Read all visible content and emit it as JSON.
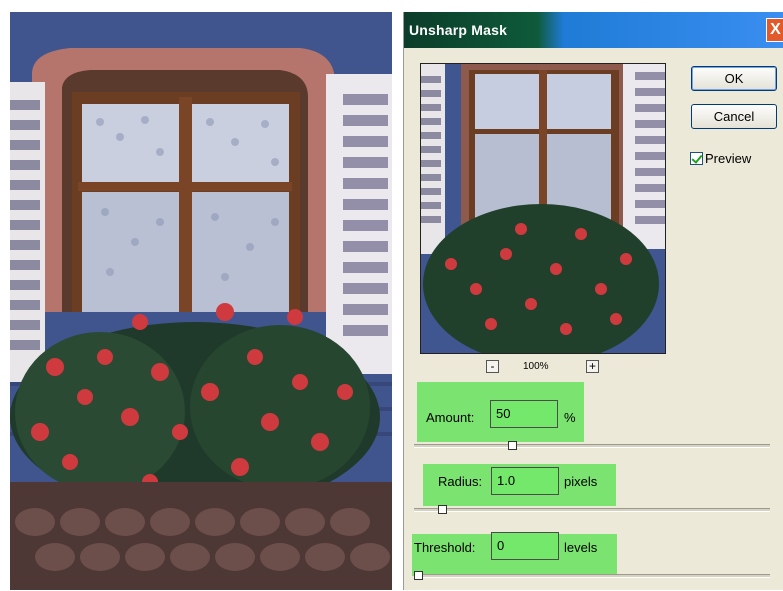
{
  "dialog": {
    "title": "Unsharp Mask",
    "close_glyph": "X",
    "ok_label": "OK",
    "cancel_label": "Cancel",
    "preview_label": "Preview",
    "preview_checked": true,
    "zoom": {
      "minus": "-",
      "plus": "+",
      "level": "100%"
    },
    "amount": {
      "label": "Amount:",
      "value": "50",
      "unit": "%",
      "slider_fraction": 0.27
    },
    "radius": {
      "label": "Radius:",
      "value": "1.0",
      "unit": "pixels",
      "slider_fraction": 0.07
    },
    "threshold": {
      "label": "Threshold:",
      "value": "0",
      "unit": "levels",
      "slider_fraction": 0.0
    }
  },
  "colors": {
    "titlebar_dark": "#0b3d2a",
    "titlebar_blue": "#3a8ef0",
    "highlight": "#7be36f",
    "dialog_bg": "#ece9d8"
  },
  "icons": [
    "close-icon",
    "zoom-out-icon",
    "zoom-in-icon",
    "checkmark-icon"
  ]
}
